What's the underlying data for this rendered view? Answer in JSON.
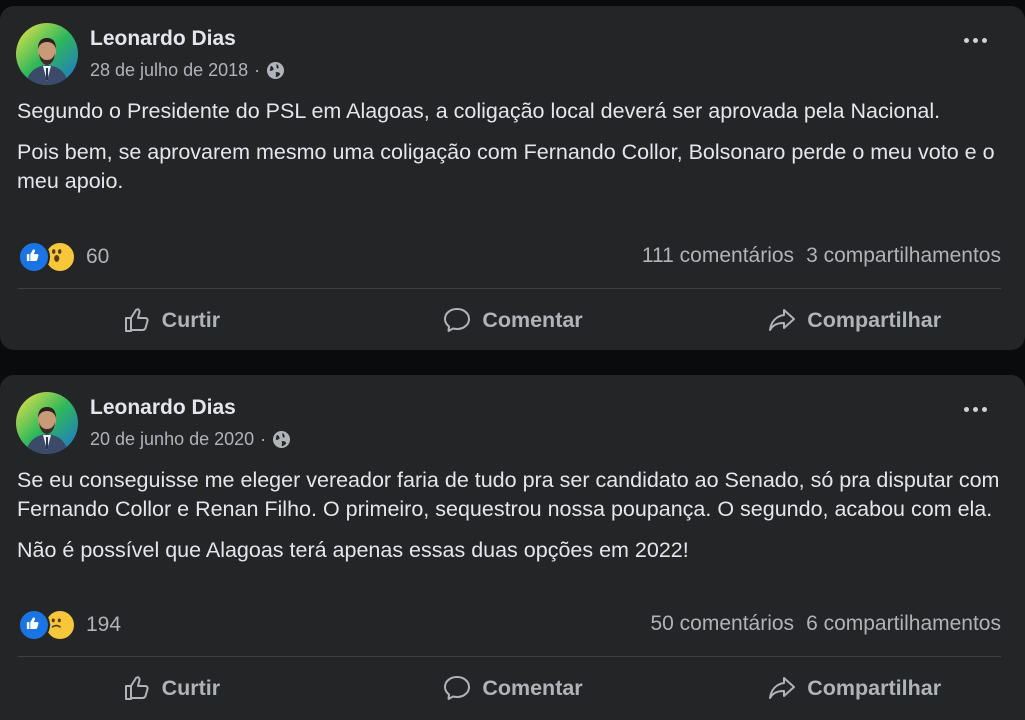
{
  "posts": [
    {
      "author": "Leonardo Dias",
      "date": "28 de julho de 2018",
      "separator": "·",
      "paragraphs": [
        "Segundo o Presidente do PSL em Alagoas, a coligação local deverá ser aprovada pela Nacional.",
        "Pois bem, se aprovarem mesmo uma coligação com Fernando Collor, Bolsonaro perde o meu voto e o meu apoio."
      ],
      "reaction_icons": [
        "like-icon",
        "wow-icon"
      ],
      "reaction_count": "60",
      "comments": "111 comentários",
      "shares": "3 compartilhamentos"
    },
    {
      "author": "Leonardo Dias",
      "date": "20 de junho de 2020",
      "separator": "·",
      "paragraphs": [
        "Se eu conseguisse me eleger vereador faria de tudo pra ser candidato ao Senado, só pra disputar com Fernando Collor e Renan Filho. O primeiro, sequestrou nossa poupança. O segundo, acabou com ela.",
        "Não é possível que Alagoas terá apenas essas duas opções em 2022!"
      ],
      "reaction_icons": [
        "like-icon",
        "sad-icon"
      ],
      "reaction_count": "194",
      "comments": "50 comentários",
      "shares": "6 compartilhamentos"
    }
  ],
  "actions": {
    "like": "Curtir",
    "comment": "Comentar",
    "share": "Compartilhar"
  },
  "colors": {
    "background": "#0a0b0c",
    "card": "#242526",
    "text_primary": "#e4e6eb",
    "text_secondary": "#b0b3b8",
    "like_blue": "#1b74e4",
    "emoji_yellow": "#f7c63b"
  }
}
